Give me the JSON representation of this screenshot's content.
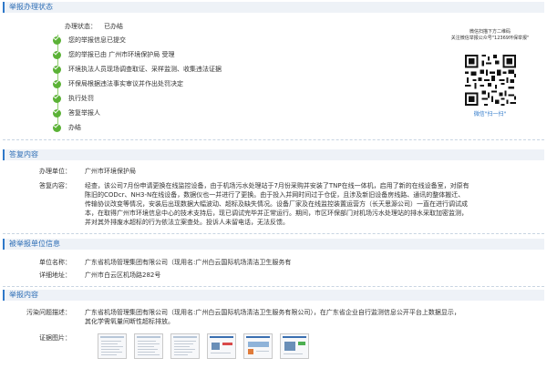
{
  "section1": {
    "title": "举报办理状态",
    "status_label": "办理状态：",
    "status_value": "已办结",
    "steps": [
      "您的举报信息已提交",
      "您的举报已由 广州市环境保护局 受理",
      "环境执法人员现场调查取证、采样监测、收集违法证据",
      "环保局根据违法事实审议并作出处罚决定",
      "执行处罚",
      "答复举报人",
      "办结"
    ]
  },
  "qr": {
    "caption": "微信扫描下方二维码\n关注微信举报公众号\"12369环保举报\"",
    "footer": "微信\"扫一扫\""
  },
  "section2": {
    "title": "答复内容",
    "unit_label": "办理单位：",
    "unit_value": "广州市环境保护局",
    "reply_label": "答复内容：",
    "reply_lines": [
      "经查，该公司7月份申请更换在线监控设备，由于机场污水处理站于7月份采购并安装了TNP在线一体机，启用了新的在线设备室，对原有",
      "陈旧的CODcr、NH3-N在线设备，数据仪也一并进行了更换。由于投入并网时间过于仓促，且涉及新旧设备房线路、通讯的整体搬迁、",
      "传输协议改变等情况，安装后出现数据大幅波动、超标及缺失情况。设备厂家及在线监控装置运营方（长天思源公司）一直在进行调试成",
      "本，在取得广州市环境信息中心的技术支持后，现已调试完毕并正常运行。期间，市区环保部门对机场污水处理站的排水采取加密监测，",
      "并对其外排废水超标的行为依法立案查处。投诉人未留电话，无法反馈。"
    ]
  },
  "section3": {
    "title": "被举报单位信息",
    "name_label": "单位名称：",
    "name_value": "广东省机场管理集团有限公司（现用名:广州白云国际机场清洁卫生服务有",
    "addr_label": "详细地址：",
    "addr_value": "广州市白云区机场路282号"
  },
  "section4": {
    "title": "举报内容",
    "issue_label": "污染问题描述：",
    "issue_lines": [
      "广东省机场管理集团有限公司（现用名:广州白云国际机场清洁卫生服务有限公司），在广东省企业自行监测信息公开平台上数据显示，",
      "其化学需氧量间断性超标排放。"
    ],
    "evidence_label": "证据图片："
  }
}
